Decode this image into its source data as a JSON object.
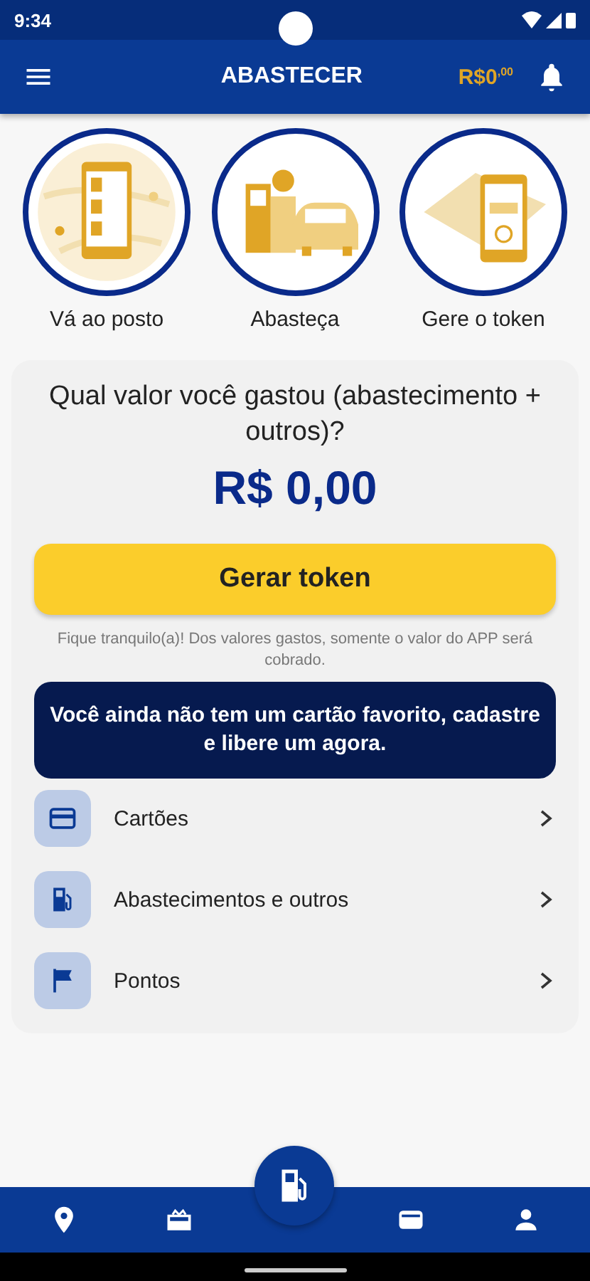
{
  "status_bar": {
    "time": "9:34"
  },
  "app_bar": {
    "title": "ABASTECER",
    "balance": "R$0$^{,00}$"
  },
  "steps": [
    {
      "kind": "map",
      "label": "Vá ao posto"
    },
    {
      "kind": "pump",
      "label": "Abasteça"
    },
    {
      "kind": "token",
      "label": "Gere o token"
    }
  ],
  "card": {
    "question": "Qual valor você gastou (abastecimento + outros)?",
    "amount": "R$ 0,00",
    "button": "Gerar token",
    "note": "Fique tranquilo(a)! Dos valores gastos, somente o valor do APP será cobrado.",
    "banner": "Você ainda não tem um cartão favorito, cadastre e libere um agora.",
    "menu": [
      {
        "kind": "card",
        "label": "Cartões"
      },
      {
        "kind": "fuel",
        "label": "Abastecimentos e outros"
      },
      {
        "kind": "flag",
        "label": "Pontos"
      }
    ]
  },
  "bottom_nav": [
    {
      "kind": "pin"
    },
    {
      "kind": "store"
    },
    {
      "kind": "fuel"
    },
    {
      "kind": "wallet"
    },
    {
      "kind": "person"
    }
  ]
}
